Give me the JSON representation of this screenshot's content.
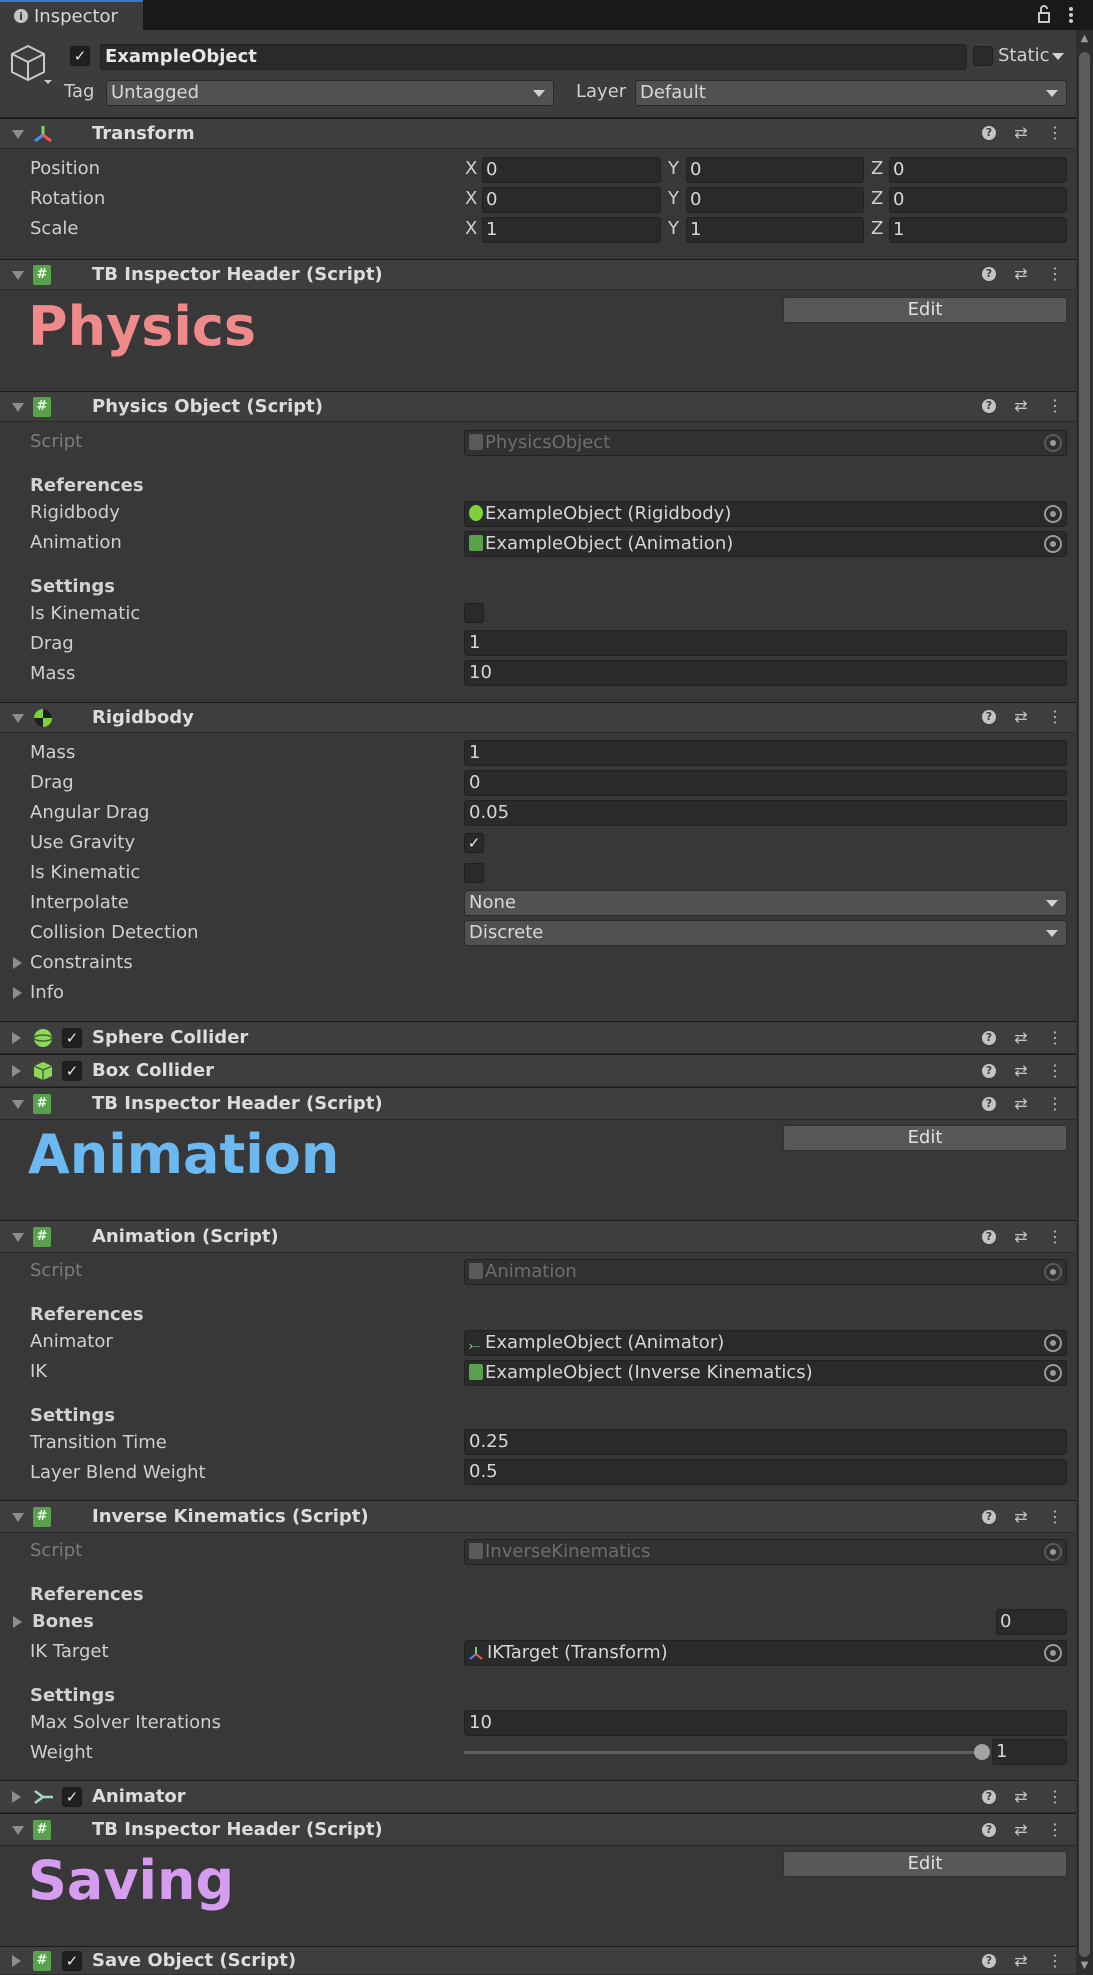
{
  "tab": {
    "label": "Inspector"
  },
  "object": {
    "name": "ExampleObject",
    "static_label": "Static",
    "tag_label": "Tag",
    "tag_value": "Untagged",
    "layer_label": "Layer",
    "layer_value": "Default"
  },
  "transform": {
    "title": "Transform",
    "rows": [
      {
        "label": "Position",
        "x": "0",
        "y": "0",
        "z": "0"
      },
      {
        "label": "Rotation",
        "x": "0",
        "y": "0",
        "z": "0"
      },
      {
        "label": "Scale",
        "x": "1",
        "y": "1",
        "z": "1"
      }
    ],
    "axis_x": "X",
    "axis_y": "Y",
    "axis_z": "Z"
  },
  "header1": {
    "title": "TB Inspector Header (Script)",
    "edit": "Edit",
    "big": "Physics",
    "color": "#f08a8a"
  },
  "physics": {
    "title": "Physics Object (Script)",
    "script_label": "Script",
    "script_value": "PhysicsObject",
    "references": "References",
    "rigidbody_label": "Rigidbody",
    "rigidbody_value": "ExampleObject (Rigidbody)",
    "animation_label": "Animation",
    "animation_value": "ExampleObject (Animation)",
    "settings": "Settings",
    "kinematic_label": "Is Kinematic",
    "drag_label": "Drag",
    "drag_value": "1",
    "mass_label": "Mass",
    "mass_value": "10"
  },
  "rigidbody": {
    "title": "Rigidbody",
    "mass_label": "Mass",
    "mass_value": "1",
    "drag_label": "Drag",
    "drag_value": "0",
    "angular_label": "Angular Drag",
    "angular_value": "0.05",
    "gravity_label": "Use Gravity",
    "kinematic_label": "Is Kinematic",
    "interp_label": "Interpolate",
    "interp_value": "None",
    "collision_label": "Collision Detection",
    "collision_value": "Discrete",
    "constraints": "Constraints",
    "info": "Info"
  },
  "sphere": {
    "title": "Sphere Collider"
  },
  "box": {
    "title": "Box Collider"
  },
  "header2": {
    "title": "TB Inspector Header (Script)",
    "edit": "Edit",
    "big": "Animation",
    "color": "#6cb9f2"
  },
  "animscript": {
    "title": "Animation (Script)",
    "script_label": "Script",
    "script_value": "Animation",
    "references": "References",
    "animator_label": "Animator",
    "animator_value": "ExampleObject (Animator)",
    "ik_label": "IK",
    "ik_value": "ExampleObject (Inverse Kinematics)",
    "settings": "Settings",
    "transition_label": "Transition Time",
    "transition_value": "0.25",
    "blend_label": "Layer Blend Weight",
    "blend_value": "0.5"
  },
  "ik": {
    "title": "Inverse Kinematics (Script)",
    "script_label": "Script",
    "script_value": "InverseKinematics",
    "references": "References",
    "bones_label": "Bones",
    "bones_value": "0",
    "target_label": "IK Target",
    "target_value": "IKTarget (Transform)",
    "settings": "Settings",
    "iter_label": "Max Solver Iterations",
    "iter_value": "10",
    "weight_label": "Weight",
    "weight_value": "1",
    "weight_fraction": 1.0
  },
  "animator": {
    "title": "Animator"
  },
  "header3": {
    "title": "TB Inspector Header (Script)",
    "edit": "Edit",
    "big": "Saving",
    "color": "#d59cf0"
  },
  "save": {
    "title": "Save Object (Script)"
  }
}
